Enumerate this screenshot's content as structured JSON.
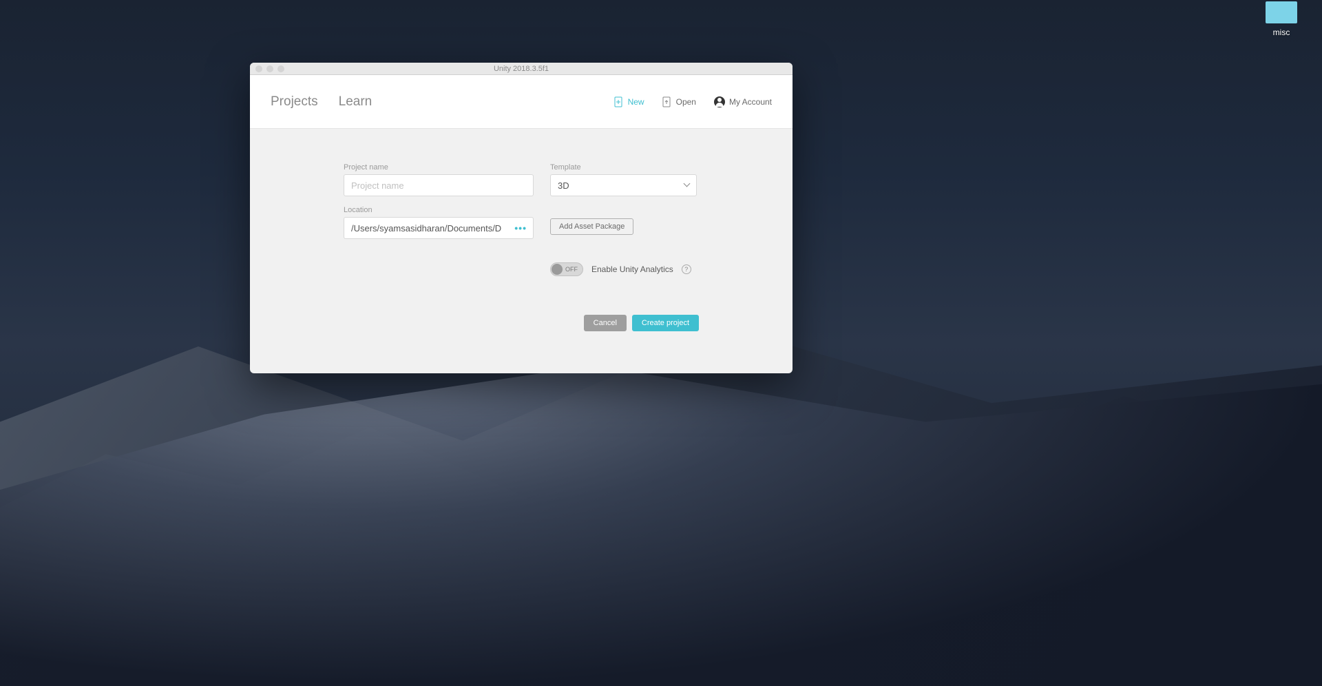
{
  "desktop": {
    "folder_label": "misc"
  },
  "window": {
    "title": "Unity 2018.3.5f1"
  },
  "tabs": {
    "projects": "Projects",
    "learn": "Learn"
  },
  "header": {
    "new_label": "New",
    "open_label": "Open",
    "account_label": "My Account"
  },
  "form": {
    "project_name_label": "Project name",
    "project_name_placeholder": "Project name",
    "project_name_value": "",
    "template_label": "Template",
    "template_value": "3D",
    "location_label": "Location",
    "location_value": "/Users/syamsasidharan/Documents/D",
    "add_asset_label": "Add Asset Package",
    "toggle_state": "OFF",
    "analytics_label": "Enable Unity Analytics",
    "help_glyph": "?",
    "browse_glyph": "•••"
  },
  "actions": {
    "cancel": "Cancel",
    "create": "Create project"
  },
  "colors": {
    "accent": "#3fbfd0"
  }
}
